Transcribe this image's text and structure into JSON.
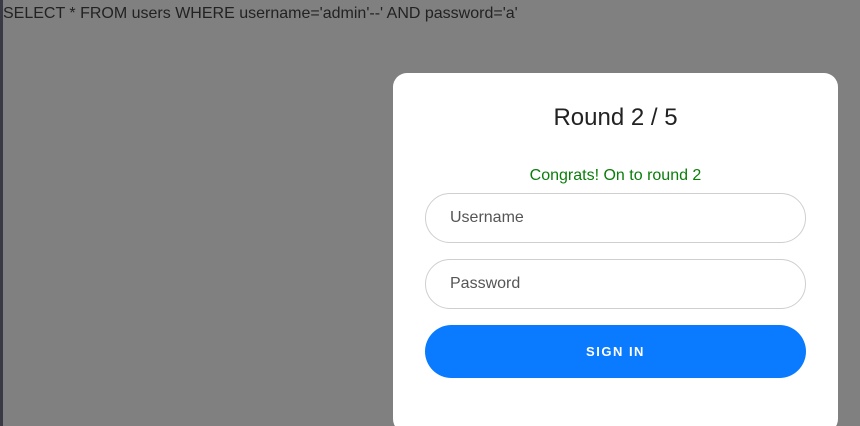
{
  "query": {
    "text": "SELECT * FROM users WHERE username='admin'--' AND password='a'"
  },
  "login_card": {
    "title": "Round 2 / 5",
    "message": "Congrats! On to round 2",
    "message_color": "#0a7d0a",
    "username": {
      "placeholder": "Username",
      "value": ""
    },
    "password": {
      "placeholder": "Password",
      "value": ""
    },
    "signin_label": "SIGN IN",
    "button_color": "#0a7bff"
  }
}
